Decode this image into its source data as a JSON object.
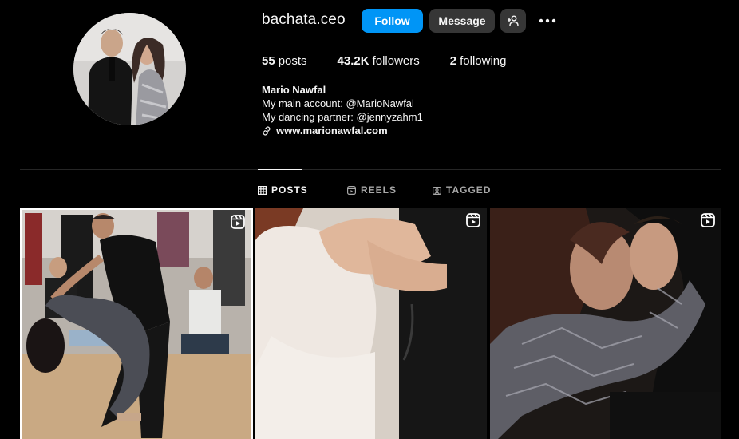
{
  "profile": {
    "username": "bachata.ceo",
    "follow_label": "Follow",
    "message_label": "Message",
    "stats": {
      "posts_count": "55",
      "posts_label": "posts",
      "followers_count": "43.2K",
      "followers_label": "followers",
      "following_count": "2",
      "following_label": "following"
    },
    "bio": {
      "name": "Mario Nawfal",
      "line1": "My main account: @MarioNawfal",
      "line2": "My dancing partner: @jennyzahm1",
      "link": "www.marionawfal.com"
    }
  },
  "tabs": [
    {
      "label": "POSTS",
      "icon": "grid-icon",
      "active": true
    },
    {
      "label": "REELS",
      "icon": "reels-icon",
      "active": false
    },
    {
      "label": "TAGGED",
      "icon": "tagged-icon",
      "active": false
    }
  ],
  "posts": [
    {
      "type": "reel",
      "icon": "reel-icon"
    },
    {
      "type": "reel",
      "icon": "reel-icon"
    },
    {
      "type": "reel",
      "icon": "reel-icon"
    }
  ],
  "colors": {
    "background": "#000000",
    "primary_button": "#0095f6",
    "secondary_button": "#363636",
    "text": "#f5f5f5",
    "muted_text": "#a8a8a8",
    "divider": "#262626"
  }
}
